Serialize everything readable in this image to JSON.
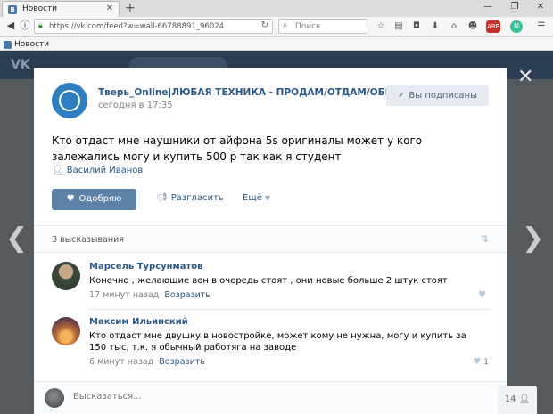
{
  "browser": {
    "tab_title": "Новости",
    "url": "https://vk.com/feed?w=wall-66788891_96024",
    "search_placeholder": "Поиск",
    "bookmark_label": "Новости"
  },
  "vk_header": {
    "logo": "VK"
  },
  "post": {
    "group_name": "Тверь_Online|ЛЮБАЯ ТЕХНИКА - ПРОДАМ/ОТДАМ/ОБМЕН",
    "time": "сегодня в 17:35",
    "subscribed_label": "Вы подписаны",
    "text": "Кто отдаст мне наушники от айфона 5s оригиналы может у кого залежались могу и купить 500 р так как я студент",
    "signer": "Василий Иванов",
    "like_label": "Одобряю",
    "share_label": "Разгласить",
    "more_label": "Ещё"
  },
  "comments": {
    "count_label": "3 высказывания",
    "items": [
      {
        "author": "Марсель Турсунматов",
        "text": "Конечно , желающие вон в очередь стоят , они новые больше 2 штук стоят",
        "time": "17 минут назад",
        "reply_label": "Возразить",
        "likes": ""
      },
      {
        "author": "Максим Ильинский",
        "text": "Кто отдаст мне двушку в новостройке, может кому не нужна, могу и купить за 150 тыс, т.к. я обычный работяга на заводе",
        "time": "6 минут назад",
        "reply_label": "Возразить",
        "likes": "1"
      }
    ]
  },
  "reply": {
    "placeholder": "Высказаться..."
  },
  "online_widget": {
    "count": "14"
  }
}
